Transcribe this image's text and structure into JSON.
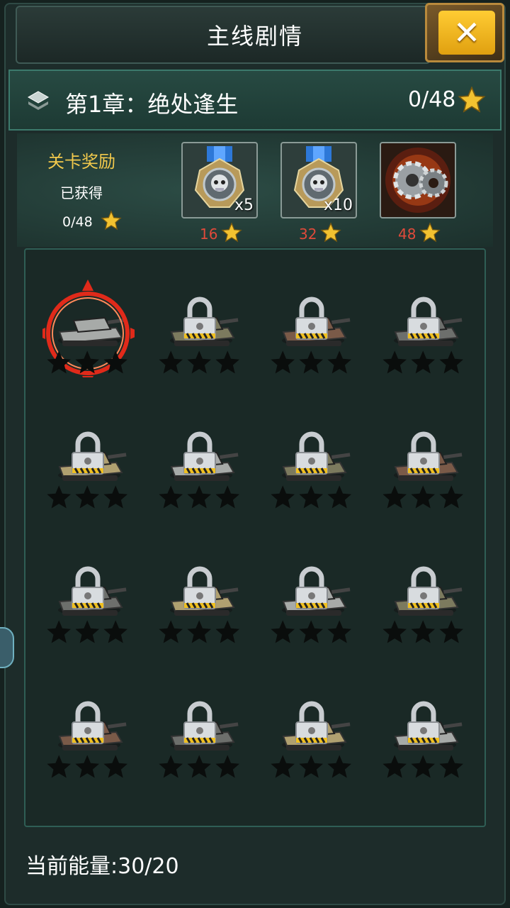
{
  "header": {
    "title": "主线剧情",
    "close_icon": "close-icon"
  },
  "chapter": {
    "title": "第1章：绝处逢生",
    "progress": "0/48"
  },
  "rewards": {
    "label": "关卡奖励",
    "obtained_label": "已获得",
    "obtained_progress": "0/48",
    "items": [
      {
        "icon": "skull-medal-icon",
        "count": "x5",
        "required": "16"
      },
      {
        "icon": "skull-medal-icon",
        "count": "x10",
        "required": "32"
      },
      {
        "icon": "gear-part-icon",
        "count": "",
        "required": "48"
      }
    ]
  },
  "stages": [
    {
      "index": 1,
      "unlocked": true,
      "stars": 0
    },
    {
      "index": 2,
      "unlocked": false,
      "stars": 0
    },
    {
      "index": 3,
      "unlocked": false,
      "stars": 0
    },
    {
      "index": 4,
      "unlocked": false,
      "stars": 0
    },
    {
      "index": 5,
      "unlocked": false,
      "stars": 0
    },
    {
      "index": 6,
      "unlocked": false,
      "stars": 0
    },
    {
      "index": 7,
      "unlocked": false,
      "stars": 0
    },
    {
      "index": 8,
      "unlocked": false,
      "stars": 0
    },
    {
      "index": 9,
      "unlocked": false,
      "stars": 0
    },
    {
      "index": 10,
      "unlocked": false,
      "stars": 0
    },
    {
      "index": 11,
      "unlocked": false,
      "stars": 0
    },
    {
      "index": 12,
      "unlocked": false,
      "stars": 0
    },
    {
      "index": 13,
      "unlocked": false,
      "stars": 0
    },
    {
      "index": 14,
      "unlocked": false,
      "stars": 0
    },
    {
      "index": 15,
      "unlocked": false,
      "stars": 0
    },
    {
      "index": 16,
      "unlocked": false,
      "stars": 0
    }
  ],
  "footer": {
    "energy": "当前能量:30/20"
  },
  "colors": {
    "accent_gold": "#f2c94c",
    "required_red": "#e04a3a",
    "panel_green": "#2f5e55"
  }
}
